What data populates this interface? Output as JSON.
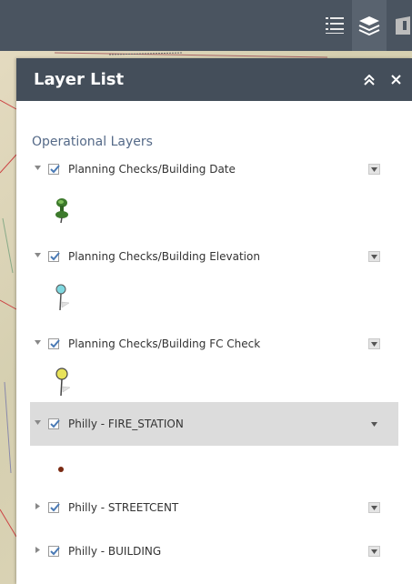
{
  "toolbar": {
    "icons": [
      "list-icon",
      "layers-icon",
      "overview-icon"
    ]
  },
  "panel": {
    "title": "Layer List",
    "collapse_icon": "double-chevron-up-icon",
    "close_icon": "close-icon",
    "section_title": "Operational Layers",
    "layers": [
      {
        "label": "Planning Checks/Building Date",
        "checked": true,
        "expanded": true,
        "legend": "green-pushpin-icon"
      },
      {
        "label": "Planning Checks/Building Elevation",
        "checked": true,
        "expanded": true,
        "legend": "cyan-flag-pin-icon"
      },
      {
        "label": "Planning Checks/Building FC Check",
        "checked": true,
        "expanded": true,
        "legend": "yellow-flag-pin-icon"
      },
      {
        "label": "Philly - FIRE_STATION",
        "checked": true,
        "expanded": true,
        "selected": true,
        "legend": "brown-dot-icon"
      },
      {
        "label": "Philly - STREETCENT",
        "checked": true,
        "expanded": false
      },
      {
        "label": "Philly - BUILDING",
        "checked": true,
        "expanded": false
      }
    ]
  },
  "colors": {
    "header_bg": "#444e5a",
    "toolbar_bg": "#4a5460",
    "section_title": "#556a88",
    "selected_row": "#dcdcdc"
  }
}
